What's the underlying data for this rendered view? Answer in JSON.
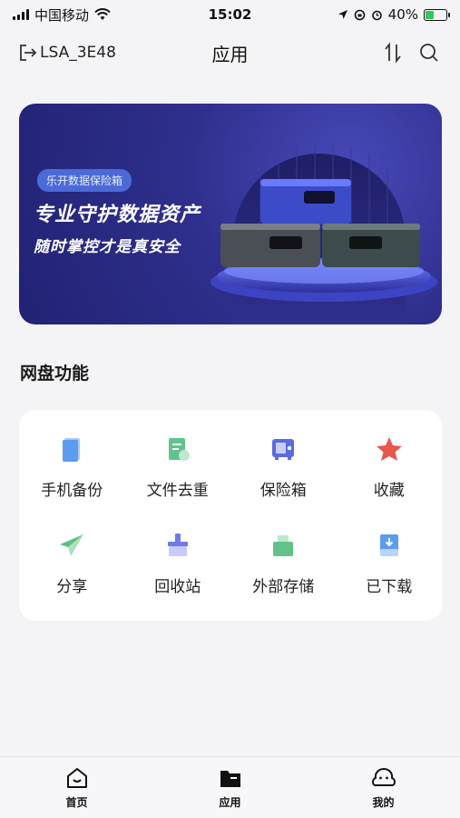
{
  "status_bar": {
    "carrier": "中国移动",
    "time": "15:02",
    "battery": "40%",
    "battery_level": 0.4
  },
  "header": {
    "device_name": "LSA_3E48",
    "title": "应用"
  },
  "banner": {
    "tag": "乐开数据保险箱",
    "headline": "专业守护数据资产",
    "subheadline": "随时掌控才是真安全"
  },
  "section": {
    "title": "网盘功能",
    "items": [
      {
        "label": "手机备份",
        "icon": "phone-backup-icon",
        "color": "#5b9bf0"
      },
      {
        "label": "文件去重",
        "icon": "file-dedupe-icon",
        "color": "#5fc48d"
      },
      {
        "label": "保险箱",
        "icon": "safe-icon",
        "color": "#5a6be0"
      },
      {
        "label": "收藏",
        "icon": "star-icon",
        "color": "#e8574b"
      },
      {
        "label": "分享",
        "icon": "paper-plane-icon",
        "color": "#5cc27f"
      },
      {
        "label": "回收站",
        "icon": "broom-icon",
        "color": "#6f7be6"
      },
      {
        "label": "外部存储",
        "icon": "usb-drive-icon",
        "color": "#62c28a"
      },
      {
        "label": "已下载",
        "icon": "download-icon",
        "color": "#5b9bf0"
      }
    ]
  },
  "bottom_nav": {
    "items": [
      {
        "label": "首页",
        "icon": "home-icon"
      },
      {
        "label": "应用",
        "icon": "folder-icon",
        "active": true
      },
      {
        "label": "我的",
        "icon": "profile-icon"
      }
    ]
  }
}
